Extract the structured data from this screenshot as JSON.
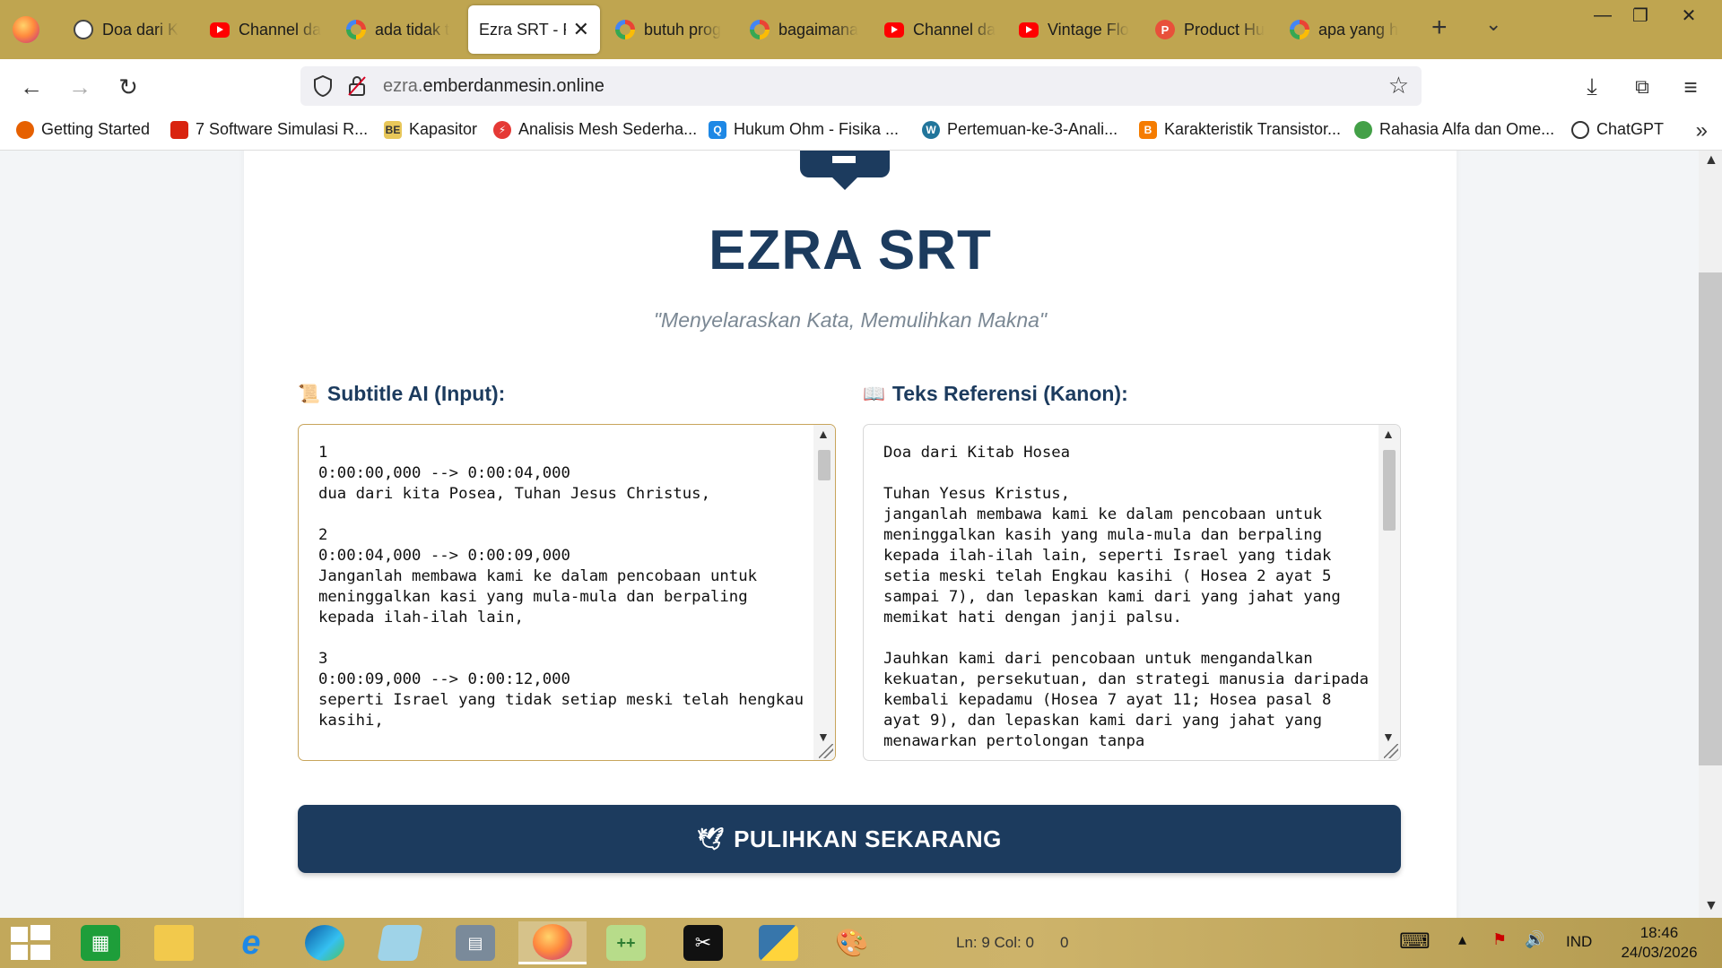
{
  "browser": {
    "tabs": [
      {
        "label": "Doa dari K",
        "icon": "openai-icon",
        "active": false
      },
      {
        "label": "Channel da",
        "icon": "youtube-icon",
        "active": false
      },
      {
        "label": "ada tidak t",
        "icon": "google-icon",
        "active": false
      },
      {
        "label": "Ezra SRT - P",
        "icon": "",
        "active": true
      },
      {
        "label": "butuh prog",
        "icon": "google-icon",
        "active": false
      },
      {
        "label": "bagaimana",
        "icon": "google-icon",
        "active": false
      },
      {
        "label": "Channel da",
        "icon": "youtube-icon",
        "active": false
      },
      {
        "label": "Vintage Flo",
        "icon": "youtube-icon",
        "active": false
      },
      {
        "label": "Product Hu",
        "icon": "producthunt-icon",
        "active": false
      },
      {
        "label": "apa yang h",
        "icon": "google-icon",
        "active": false
      }
    ],
    "url_prefix": "ezra.",
    "url_domain": "emberdanmesin.online",
    "bookmarks": [
      {
        "label": "Getting Started",
        "color": "#e66000"
      },
      {
        "label": "7 Software Simulasi R...",
        "color": "#d9230f"
      },
      {
        "label": "Kapasitor",
        "color": "#e8c75a"
      },
      {
        "label": "Analisis Mesh Sederha...",
        "color": "#e53935"
      },
      {
        "label": "Hukum Ohm - Fisika ...",
        "color": "#1e88e5"
      },
      {
        "label": "Pertemuan-ke-3-Anali...",
        "color": "#21759b"
      },
      {
        "label": "Karakteristik Transistor...",
        "color": "#f57c00"
      },
      {
        "label": "Rahasia Alfa dan Ome...",
        "color": "#43a047"
      },
      {
        "label": "ChatGPT",
        "color": "#333333"
      }
    ]
  },
  "page": {
    "title": "EZRA SRT",
    "tagline": "\"Menyelaraskan Kata, Memulihkan Makna\"",
    "input_label": "Subtitle AI (Input):",
    "ref_label": "Teks Referensi (Kanon):",
    "input_text": "1\n0:00:00,000 --> 0:00:04,000\ndua dari kita Posea, Tuhan Jesus Christus,\n\n2\n0:00:04,000 --> 0:00:09,000\nJanganlah membawa kami ke dalam pencobaan untuk meninggalkan kasi yang mula-mula dan berpaling kepada ilah-ilah lain,\n\n3\n0:00:09,000 --> 0:00:12,000\nseperti Israel yang tidak setiap meski telah hengkau kasihi,",
    "ref_text": "Doa dari Kitab Hosea\n\nTuhan Yesus Kristus,\njanganlah membawa kami ke dalam pencobaan untuk meninggalkan kasih yang mula-mula dan berpaling kepada ilah-ilah lain, seperti Israel yang tidak setia meski telah Engkau kasihi ( Hosea 2 ayat 5 sampai 7), dan lepaskan kami dari yang jahat yang memikat hati dengan janji palsu.\n\nJauhkan kami dari pencobaan untuk mengandalkan kekuatan, persekutuan, dan strategi manusia daripada kembali kepadamu (Hosea 7 ayat 11; Hosea pasal 8 ayat 9), dan lepaskan kami dari yang jahat yang menawarkan pertolongan tanpa",
    "button_label": "PULIHKAN SEKARANG",
    "accent_color": "#1c3b5e"
  },
  "taskbar": {
    "status_ln": "Ln: 9  Col: 0",
    "status_zero": "0",
    "lang": "IND",
    "time": "18:46",
    "date": "24/03/2026"
  }
}
